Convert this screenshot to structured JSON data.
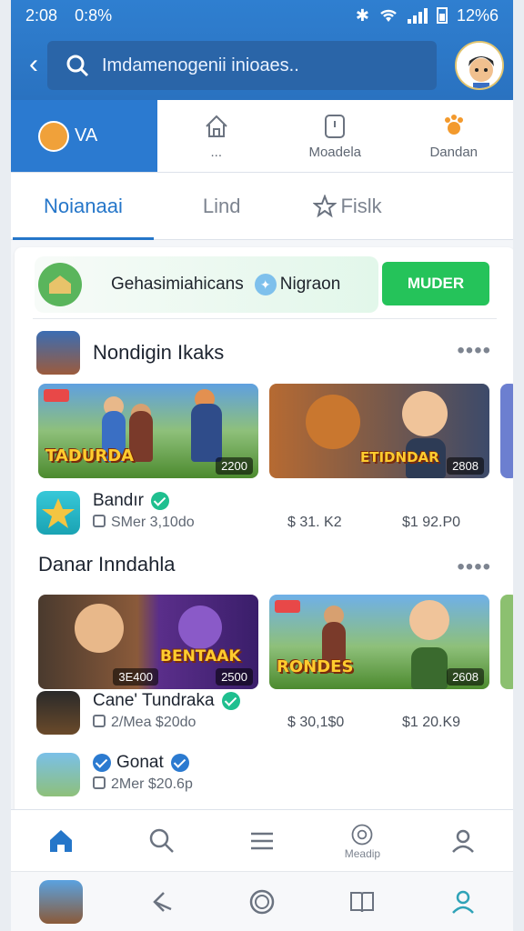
{
  "status": {
    "time": "2:08",
    "extra": "0:8%",
    "battery": "12%6"
  },
  "search": {
    "text": "Imdamenogenii inioaes.."
  },
  "categories": [
    {
      "label": "VA"
    },
    {
      "label": "..."
    },
    {
      "label": "Moadela"
    },
    {
      "label": "Dandan"
    }
  ],
  "subtabs": [
    "Noianaai",
    "Lind",
    "Fislk"
  ],
  "promo": {
    "text1": "Gehasimiahicans",
    "text2": "Nigraon",
    "button": "MUDER"
  },
  "section1": {
    "title": "Nondigin Ikaks",
    "more": "••••",
    "thumbs": [
      {
        "title": "TADURDA",
        "count": "2200"
      },
      {
        "title": "ETIDNDAR",
        "count": "2808"
      }
    ],
    "app": {
      "name": "Bandır",
      "meta": "SMer  3,10do",
      "price1": "$ 31. K2",
      "price2": "$1 92.P0"
    }
  },
  "section2": {
    "title": "Danar Inndahla",
    "more": "••••",
    "thumbs": [
      {
        "title": "BENTAAK",
        "count": "2500",
        "count2": "3E400"
      },
      {
        "title": "RONDES",
        "count": "2608"
      }
    ],
    "apps": [
      {
        "name": "Cane' Tundraka",
        "meta": "2/Mea  $20do",
        "price1": "$ 30,1$0",
        "price2": "$1 20.K9"
      },
      {
        "name": "Gonat",
        "meta": "2Mer  $20.6p",
        "price1": "",
        "price2": ""
      }
    ]
  },
  "nav1": [
    {
      "label": "",
      "icon": "home-icon"
    },
    {
      "label": "",
      "icon": "search-icon"
    },
    {
      "label": "",
      "icon": "menu-icon"
    },
    {
      "label": "Meadip",
      "icon": "clock-icon"
    },
    {
      "label": "",
      "icon": "profile-icon"
    }
  ],
  "colors": {
    "accent": "#2b7ad0",
    "green": "#25c35a"
  }
}
